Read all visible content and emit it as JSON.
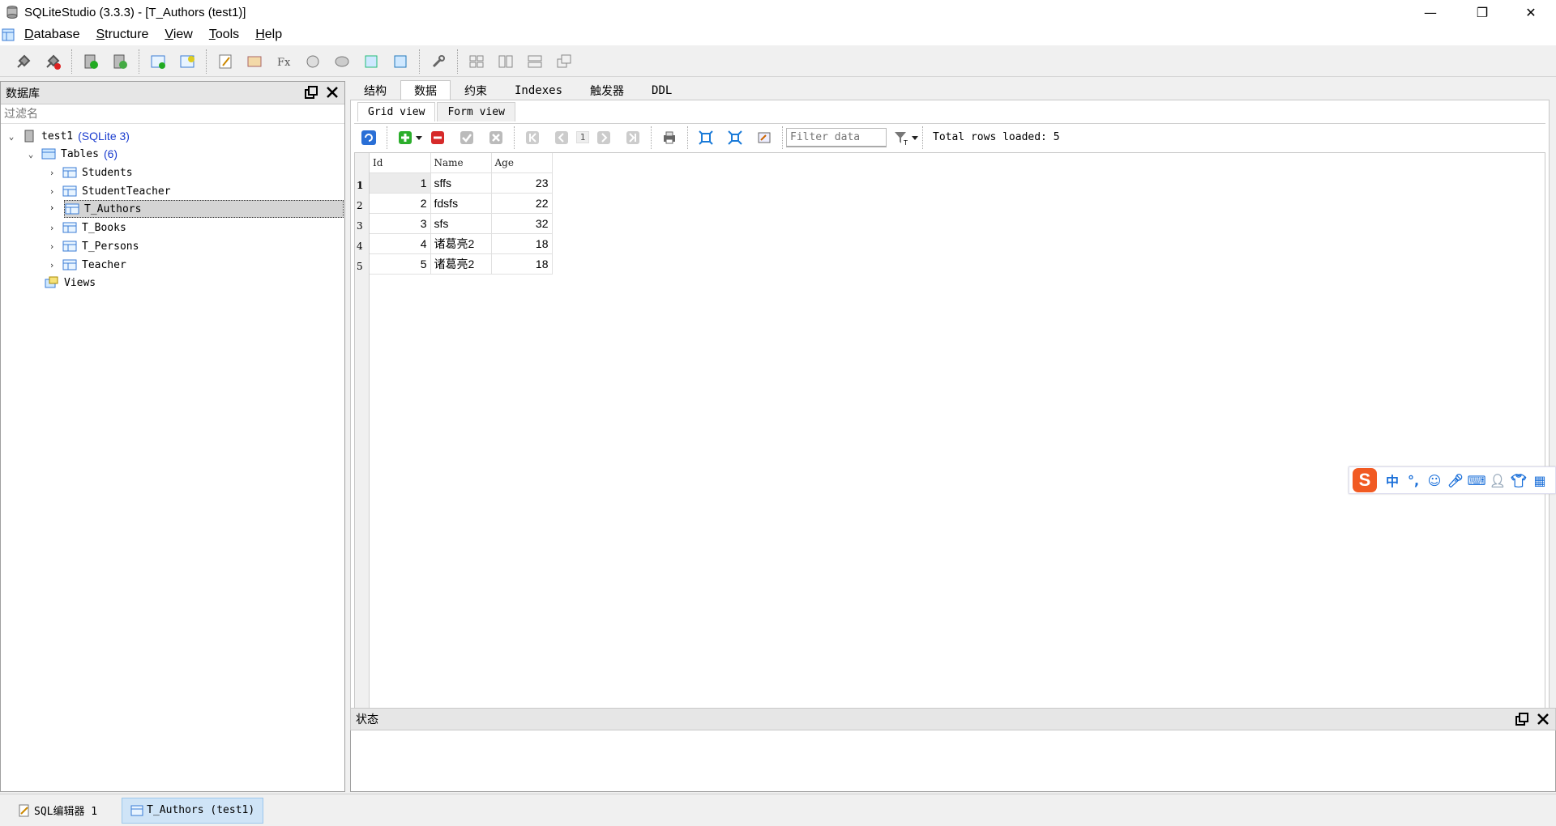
{
  "window": {
    "title": "SQLiteStudio (3.3.3) - [T_Authors (test1)]",
    "minimize_glyph": "—",
    "restore_glyph": "❐",
    "close_glyph": "✕"
  },
  "menu": {
    "items": [
      {
        "label": "Database",
        "ul": "D",
        "rest": "atabase"
      },
      {
        "label": "Structure",
        "ul": "S",
        "rest": "tructure"
      },
      {
        "label": "View",
        "ul": "V",
        "rest": "iew"
      },
      {
        "label": "Tools",
        "ul": "T",
        "rest": "ools"
      },
      {
        "label": "Help",
        "ul": "H",
        "rest": "elp"
      }
    ]
  },
  "db_panel": {
    "title": "数据库",
    "filter_placeholder": "过滤名",
    "tree": {
      "db_name": "test1",
      "db_type": "(SQLite 3)",
      "tables_label": "Tables",
      "tables_count": "(6)",
      "tables": [
        "Students",
        "StudentTeacher",
        "T_Authors",
        "T_Books",
        "T_Persons",
        "Teacher"
      ],
      "selected_table": "T_Authors",
      "views_label": "Views"
    }
  },
  "editor_tabs": [
    "结构",
    "数据",
    "约束",
    "Indexes",
    "触发器",
    "DDL"
  ],
  "active_editor_tab": "数据",
  "view_tabs": [
    "Grid view",
    "Form view"
  ],
  "active_view_tab": "Grid view",
  "grid_toolbar": {
    "page_number": "1",
    "filter_placeholder": "Filter data",
    "rows_info": "Total rows loaded: 5"
  },
  "grid": {
    "columns": [
      "Id",
      "Name",
      "Age"
    ],
    "rows": [
      {
        "num": "1",
        "id": "1",
        "name": "sffs",
        "age": "23"
      },
      {
        "num": "2",
        "id": "2",
        "name": "fdsfs",
        "age": "22"
      },
      {
        "num": "3",
        "id": "3",
        "name": "sfs",
        "age": "32"
      },
      {
        "num": "4",
        "id": "4",
        "name": "诸葛亮2",
        "age": "18"
      },
      {
        "num": "5",
        "id": "5",
        "name": "诸葛亮2",
        "age": "18"
      }
    ]
  },
  "status_panel": {
    "title": "状态"
  },
  "taskbar": {
    "items": [
      "SQL编辑器 1",
      "T_Authors (test1)"
    ],
    "active": "T_Authors (test1)"
  },
  "ime": {
    "logo": "S",
    "mode": "中",
    "punct": "°,"
  },
  "colors": {
    "accent_blue": "#1a3ccf",
    "selection_bg": "#cfe4f7",
    "ime_orange": "#f15a22"
  }
}
